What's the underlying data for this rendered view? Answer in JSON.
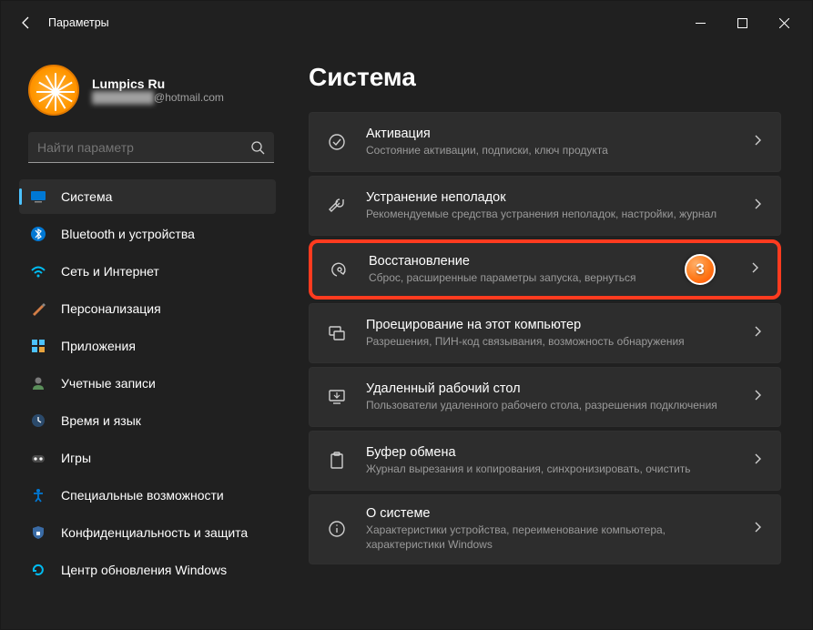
{
  "window": {
    "title": "Параметры"
  },
  "user": {
    "name": "Lumpics Ru",
    "email_blurred": "████████",
    "email_domain": "@hotmail.com"
  },
  "search": {
    "placeholder": "Найти параметр"
  },
  "sidebar": {
    "items": [
      {
        "label": "Система",
        "icon": "system",
        "active": true
      },
      {
        "label": "Bluetooth и устройства",
        "icon": "bluetooth"
      },
      {
        "label": "Сеть и Интернет",
        "icon": "wifi"
      },
      {
        "label": "Персонализация",
        "icon": "paint"
      },
      {
        "label": "Приложения",
        "icon": "apps"
      },
      {
        "label": "Учетные записи",
        "icon": "account"
      },
      {
        "label": "Время и язык",
        "icon": "time"
      },
      {
        "label": "Игры",
        "icon": "gaming"
      },
      {
        "label": "Специальные возможности",
        "icon": "accessibility"
      },
      {
        "label": "Конфиденциальность и защита",
        "icon": "privacy"
      },
      {
        "label": "Центр обновления Windows",
        "icon": "update"
      }
    ]
  },
  "main": {
    "title": "Система",
    "tiles": [
      {
        "icon": "activation",
        "title": "Активация",
        "sub": "Состояние активации, подписки, ключ продукта"
      },
      {
        "icon": "troubleshoot",
        "title": "Устранение неполадок",
        "sub": "Рекомендуемые средства устранения неполадок, настройки, журнал"
      },
      {
        "icon": "recovery",
        "title": "Восстановление",
        "sub": "Сброс, расширенные параметры запуска, вернуться",
        "highlight": true,
        "badge": "3"
      },
      {
        "icon": "projecting",
        "title": "Проецирование на этот компьютер",
        "sub": "Разрешения, ПИН-код связывания, возможность обнаружения"
      },
      {
        "icon": "remote",
        "title": "Удаленный рабочий стол",
        "sub": "Пользователи удаленного рабочего стола, разрешения подключения"
      },
      {
        "icon": "clipboard",
        "title": "Буфер обмена",
        "sub": "Журнал вырезания и копирования, синхронизировать, очистить"
      },
      {
        "icon": "about",
        "title": "О системе",
        "sub": "Характеристики устройства, переименование компьютера, характеристики Windows"
      }
    ]
  }
}
